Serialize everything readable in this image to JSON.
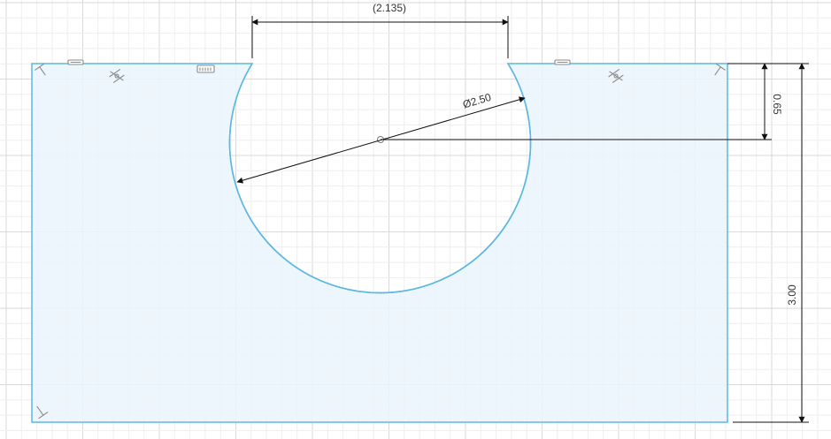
{
  "viewport": {
    "name": "sketch-canvas",
    "colors": {
      "background": "#ffffff",
      "grid_minor": "#eeeeee",
      "grid_major": "#d9d9d9",
      "profile_fill": "#eaf4fb",
      "profile_edge": "#5cb8e0",
      "dimension": "#111111",
      "constraint": "#8a8a8a"
    }
  },
  "dimensions": {
    "top_width": "(2.135)",
    "diameter": "Ø2.50",
    "center_offset": "0.65",
    "total_height": "3.00"
  },
  "constraints": [
    {
      "type": "horizontal",
      "icon": "horizontal-constraint-icon"
    },
    {
      "type": "horizontal",
      "icon": "horizontal-constraint-icon"
    },
    {
      "type": "tangent",
      "icon": "tangent-constraint-icon"
    },
    {
      "type": "tangent",
      "icon": "tangent-constraint-icon"
    },
    {
      "type": "fix",
      "icon": "fix-constraint-icon"
    },
    {
      "type": "coincident",
      "icon": "coincident-constraint-icon"
    },
    {
      "type": "coincident",
      "icon": "coincident-constraint-icon"
    },
    {
      "type": "coincident",
      "icon": "coincident-constraint-icon"
    }
  ]
}
